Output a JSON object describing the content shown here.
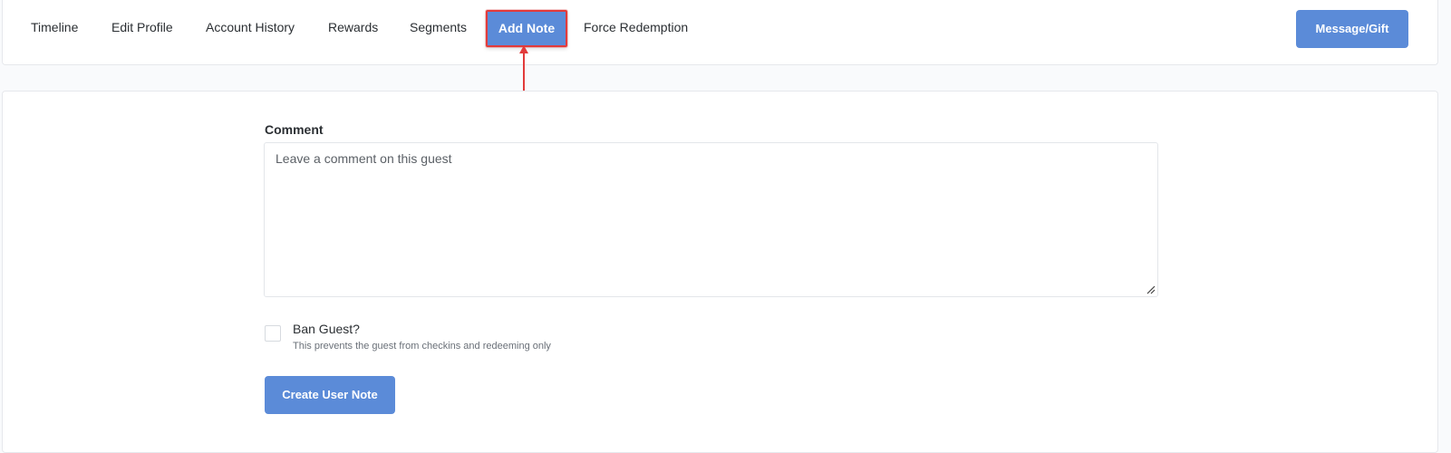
{
  "tabs": [
    {
      "label": "Timeline"
    },
    {
      "label": "Edit Profile"
    },
    {
      "label": "Account History"
    },
    {
      "label": "Rewards"
    },
    {
      "label": "Segments"
    },
    {
      "label": "Add Note",
      "active": true
    },
    {
      "label": "Force Redemption"
    }
  ],
  "header": {
    "message_gift_label": "Message/Gift"
  },
  "form": {
    "comment_label": "Comment",
    "comment_placeholder": "Leave a comment on this guest",
    "comment_value": "",
    "ban_label": "Ban Guest?",
    "ban_help": "This prevents the guest from checkins and redeeming only",
    "ban_checked": false,
    "submit_label": "Create User Note"
  },
  "colors": {
    "primary": "#5b8bd8",
    "highlight": "#e23b3b",
    "page_bg": "#f9fafc"
  }
}
